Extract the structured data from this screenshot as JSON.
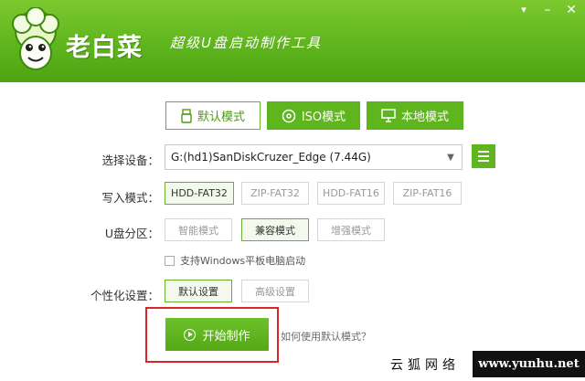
{
  "header": {
    "brand": "老白菜",
    "slogan": "超级U盘启动制作工具",
    "colors": {
      "accent": "#5fb51d",
      "accent_dark": "#4ea312",
      "highlight": "#d9262b"
    },
    "window_buttons": [
      {
        "name": "skin-icon",
        "glyph": "👕"
      },
      {
        "name": "minimize-icon",
        "glyph": "—"
      },
      {
        "name": "close-icon",
        "glyph": "✕"
      }
    ]
  },
  "tabs": [
    {
      "label": "默认模式",
      "active": true,
      "icon": "usb-drive-icon"
    },
    {
      "label": "ISO模式",
      "active": false,
      "icon": "disc-icon"
    },
    {
      "label": "本地模式",
      "active": false,
      "icon": "monitor-icon"
    }
  ],
  "device": {
    "label": "选择设备：",
    "value": "G:(hd1)SanDiskCruzer_Edge (7.44G)"
  },
  "write_mode": {
    "label": "写入模式：",
    "options": [
      "HDD-FAT32",
      "ZIP-FAT32",
      "HDD-FAT16",
      "ZIP-FAT16"
    ],
    "selected": "HDD-FAT32"
  },
  "partition": {
    "label": "U盘分区：",
    "options": [
      "智能模式",
      "兼容模式",
      "增强模式"
    ],
    "selected": "兼容模式"
  },
  "windows_tablet": {
    "label": "支持Windows平板电脑启动",
    "checked": false
  },
  "personalize": {
    "label": "个性化设置：",
    "options": [
      "默认设置",
      "高级设置"
    ],
    "selected": "默认设置"
  },
  "actions": {
    "start_label": "开始制作",
    "help_link": "如何使用默认模式？"
  },
  "watermark": {
    "cn": "云狐网络",
    "url": "www.yunhu.net"
  }
}
